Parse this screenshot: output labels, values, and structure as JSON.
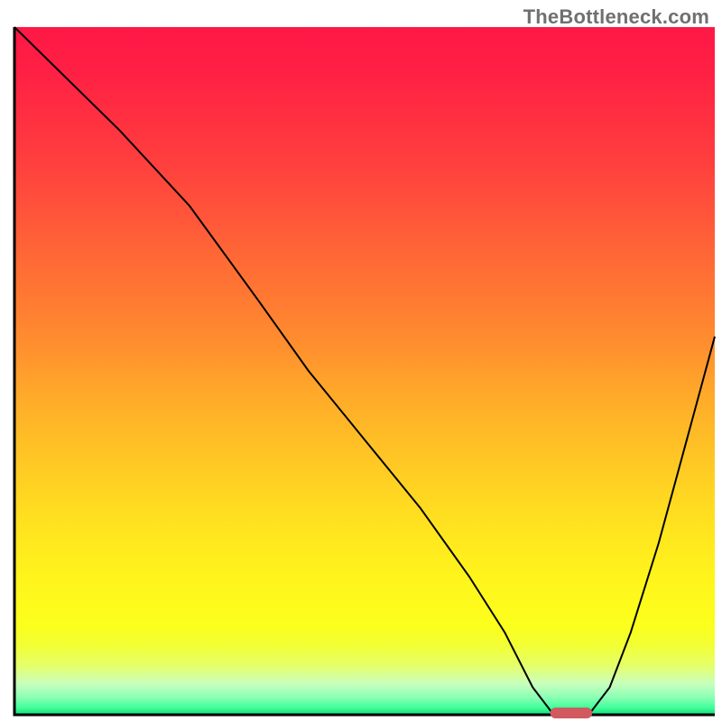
{
  "watermark": "TheBottleneck.com",
  "chart_data": {
    "type": "line",
    "title": "",
    "xlabel": "",
    "ylabel": "",
    "xlim": [
      0,
      100
    ],
    "ylim": [
      0,
      100
    ],
    "grid": false,
    "legend": false,
    "background_gradient": {
      "stops": [
        {
          "offset": 0.0,
          "color": "#ff1846"
        },
        {
          "offset": 0.06,
          "color": "#ff1f44"
        },
        {
          "offset": 0.13,
          "color": "#ff2f41"
        },
        {
          "offset": 0.2,
          "color": "#ff403e"
        },
        {
          "offset": 0.27,
          "color": "#ff543a"
        },
        {
          "offset": 0.33,
          "color": "#ff6736"
        },
        {
          "offset": 0.4,
          "color": "#ff7b32"
        },
        {
          "offset": 0.47,
          "color": "#ff912e"
        },
        {
          "offset": 0.53,
          "color": "#ffa82a"
        },
        {
          "offset": 0.6,
          "color": "#ffbe26"
        },
        {
          "offset": 0.67,
          "color": "#ffd322"
        },
        {
          "offset": 0.73,
          "color": "#ffe41f"
        },
        {
          "offset": 0.8,
          "color": "#fff41c"
        },
        {
          "offset": 0.87,
          "color": "#fcff1c"
        },
        {
          "offset": 0.9,
          "color": "#f2ff36"
        },
        {
          "offset": 0.93,
          "color": "#e4ff6e"
        },
        {
          "offset": 0.955,
          "color": "#c8ffbe"
        },
        {
          "offset": 0.975,
          "color": "#8affb4"
        },
        {
          "offset": 0.99,
          "color": "#3eff9a"
        },
        {
          "offset": 1.0,
          "color": "#17d877"
        }
      ]
    },
    "series": [
      {
        "name": "bottleneck-curve",
        "color": "#000000",
        "stroke_width": 2,
        "x": [
          0,
          5,
          15,
          25,
          35,
          42,
          50,
          58,
          65,
          70,
          74,
          77,
          82,
          85,
          88,
          92,
          96,
          100
        ],
        "y": [
          100,
          95,
          85,
          74,
          60,
          50,
          40,
          30,
          20,
          12,
          4,
          0,
          0,
          4,
          12,
          25,
          40,
          55
        ]
      }
    ],
    "marker": {
      "name": "optimal-marker",
      "color": "#d15a5e",
      "x_center": 79.5,
      "y": 0,
      "width": 6,
      "height": 2
    },
    "axis_line_color": "#000000"
  }
}
